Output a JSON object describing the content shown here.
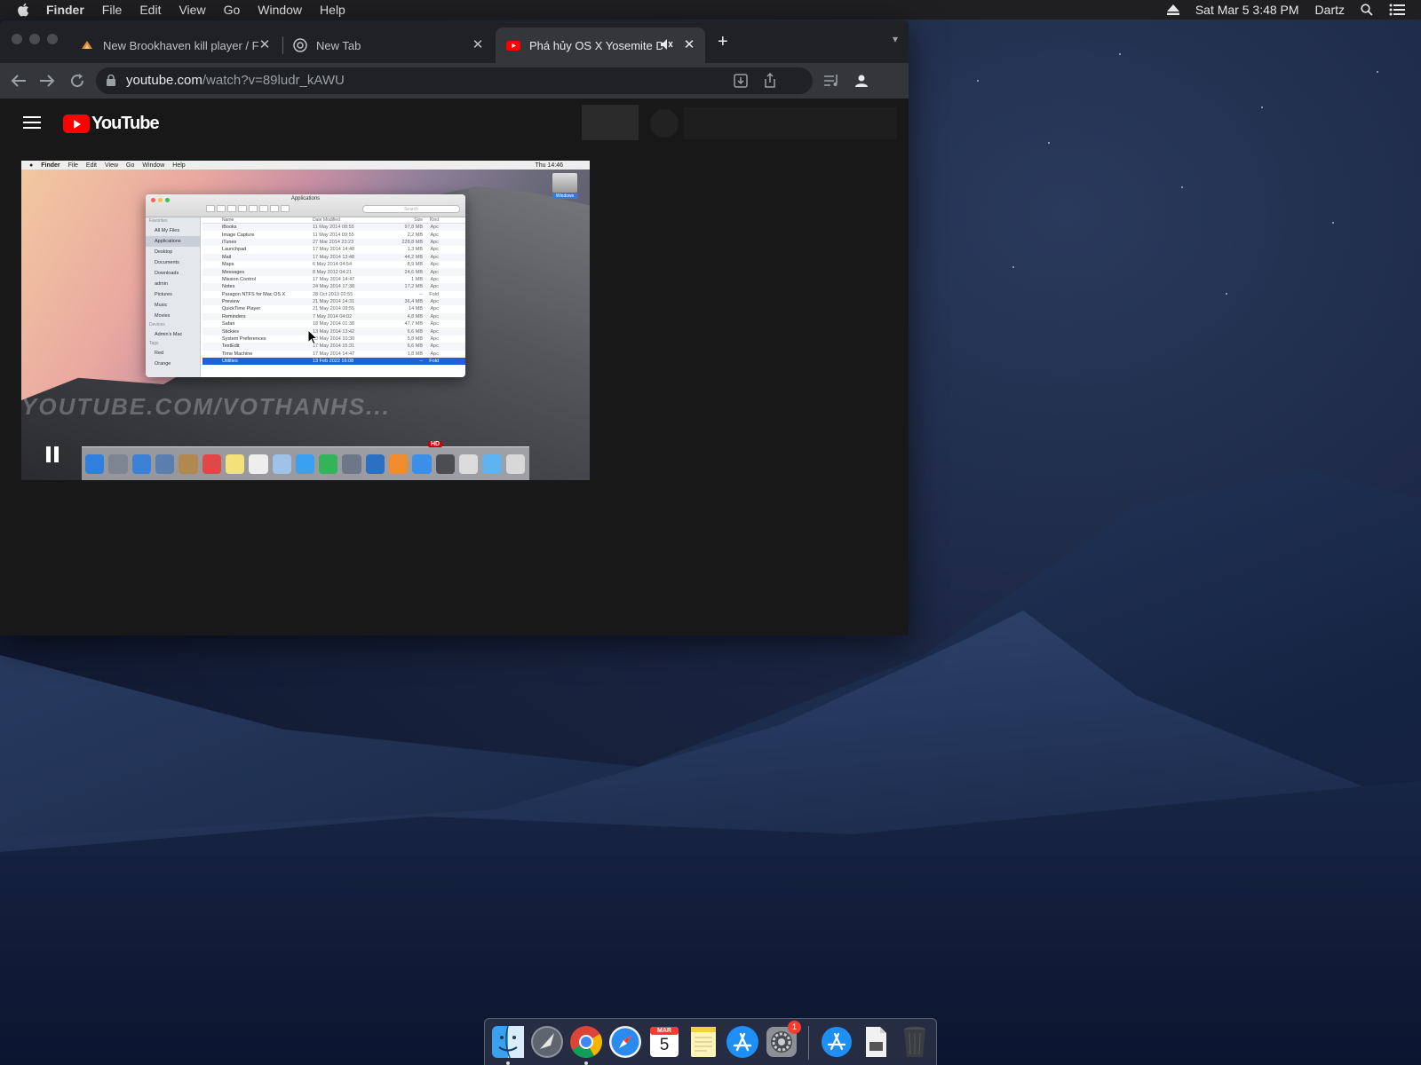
{
  "menubar": {
    "app_name": "Finder",
    "items": [
      "File",
      "Edit",
      "View",
      "Go",
      "Window",
      "Help"
    ],
    "clock": "Sat Mar 5  3:48 PM",
    "user": "Dartz"
  },
  "browser": {
    "tabs": [
      {
        "title": "New Brookhaven kill player / F",
        "favicon": "brookhaven-icon"
      },
      {
        "title": "New Tab",
        "favicon": "chrome-icon"
      },
      {
        "title": "Phá hủy OS X Yosemite DP",
        "favicon": "youtube-icon",
        "muted": true
      }
    ],
    "active_tab": 2,
    "url_host": "youtube.com",
    "url_path": "/watch?v=89ludr_kAWU"
  },
  "youtube": {
    "logo_text": "YouTube"
  },
  "video": {
    "inner_menubar": [
      "Finder",
      "File",
      "Edit",
      "View",
      "Go",
      "Window",
      "Help"
    ],
    "inner_clock": "Thu 14:46",
    "hdd_label": "Windows",
    "finder_title": "Applications",
    "search_placeholder": "Search",
    "columns": [
      "Name",
      "Date Modified",
      "Size",
      "Kind"
    ],
    "sidebar": [
      {
        "type": "header",
        "label": "Favorites"
      },
      {
        "label": "All My Files"
      },
      {
        "label": "Applications",
        "selected": true
      },
      {
        "label": "Desktop"
      },
      {
        "label": "Documents"
      },
      {
        "label": "Downloads"
      },
      {
        "label": "admin"
      },
      {
        "label": "Pictures"
      },
      {
        "label": "Music"
      },
      {
        "label": "Movies"
      },
      {
        "type": "header",
        "label": "Devices"
      },
      {
        "label": "Admin's Mac"
      },
      {
        "type": "header",
        "label": "Tags"
      },
      {
        "label": "Red"
      },
      {
        "label": "Orange"
      }
    ],
    "rows": [
      {
        "name": "iBooks",
        "date": "11 May 2014 08:55",
        "size": "97,8 MB",
        "kind": "Apc"
      },
      {
        "name": "Image Capture",
        "date": "11 May 2014 09:55",
        "size": "2,2 MB",
        "kind": "Apc"
      },
      {
        "name": "iTunes",
        "date": "27 Mar 2014 23:23",
        "size": "228,8 MB",
        "kind": "Apc"
      },
      {
        "name": "Launchpad",
        "date": "17 May 2014 14:48",
        "size": "1,3 MB",
        "kind": "Apc"
      },
      {
        "name": "Mail",
        "date": "17 May 2014 13:48",
        "size": "44,2 MB",
        "kind": "Apc"
      },
      {
        "name": "Maps",
        "date": "6 May 2014 04:54",
        "size": "8,9 MB",
        "kind": "Apc"
      },
      {
        "name": "Messages",
        "date": "8 May 2012 04:21",
        "size": "24,6 MB",
        "kind": "Apc"
      },
      {
        "name": "Mission Control",
        "date": "17 May 2014 14:47",
        "size": "1 MB",
        "kind": "Apc"
      },
      {
        "name": "Notes",
        "date": "24 May 2014 17:38",
        "size": "17,2 MB",
        "kind": "Apc"
      },
      {
        "name": "Paragon NTFS for Mac OS X",
        "date": "28 Oct 2013 02:55",
        "size": "--",
        "kind": "Fold"
      },
      {
        "name": "Preview",
        "date": "21 May 2014 14:31",
        "size": "36,4 MB",
        "kind": "Apc"
      },
      {
        "name": "QuickTime Player",
        "date": "21 May 2014 09:55",
        "size": "14 MB",
        "kind": "Apc"
      },
      {
        "name": "Reminders",
        "date": "7 May 2014 04:02",
        "size": "4,8 MB",
        "kind": "Apc"
      },
      {
        "name": "Safari",
        "date": "18 May 2014 01:38",
        "size": "47,7 MB",
        "kind": "Apc"
      },
      {
        "name": "Stickies",
        "date": "13 May 2014 13:42",
        "size": "6,6 MB",
        "kind": "Apc"
      },
      {
        "name": "System Preferences",
        "date": "30 May 2014 10:30",
        "size": "5,8 MB",
        "kind": "Apc"
      },
      {
        "name": "TextEdit",
        "date": "17 May 2014 15:31",
        "size": "6,6 MB",
        "kind": "Apc"
      },
      {
        "name": "Time Machine",
        "date": "17 May 2014 14:47",
        "size": "1,8 MB",
        "kind": "Apc"
      },
      {
        "name": "Utilities",
        "date": "13 Feb 2022 16:08",
        "size": "--",
        "kind": "Fold",
        "selected": true
      }
    ],
    "watermark": "YOUTUBE.COM/VOTHANHS...",
    "hd_badge": "HD"
  },
  "dock": {
    "apps": [
      {
        "name": "finder-icon",
        "running": true
      },
      {
        "name": "launchpad-icon"
      },
      {
        "name": "chrome-icon",
        "running": true
      },
      {
        "name": "safari-icon"
      },
      {
        "name": "calendar-icon",
        "month": "MAR",
        "day": "5"
      },
      {
        "name": "notes-icon"
      },
      {
        "name": "app-store-icon"
      },
      {
        "name": "system-preferences-icon",
        "badge": "1"
      }
    ],
    "others": [
      {
        "name": "applications-folder-icon"
      },
      {
        "name": "document-icon"
      },
      {
        "name": "trash-icon"
      }
    ]
  }
}
